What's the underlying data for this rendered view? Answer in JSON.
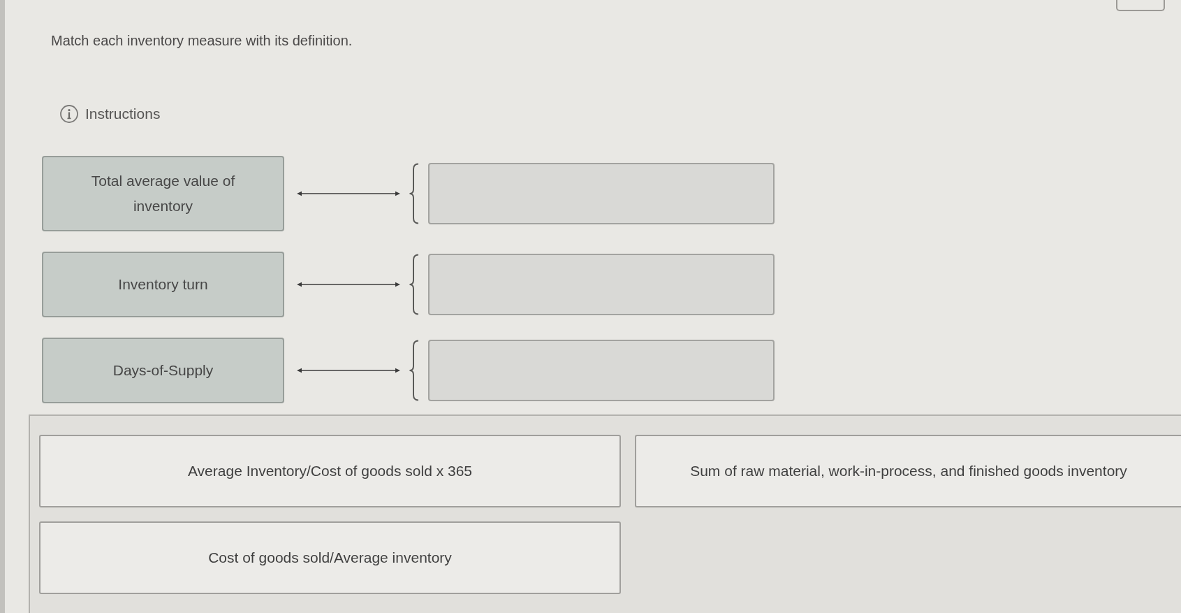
{
  "prompt": "Match each inventory measure with its definition.",
  "instructions": {
    "label": "Instructions"
  },
  "match_rows": [
    {
      "term": "Total average value of inventory"
    },
    {
      "term": "Inventory turn"
    },
    {
      "term": "Days-of-Supply"
    }
  ],
  "answer_choices": [
    "Average Inventory/Cost of goods sold x 365",
    "Sum of raw material, work-in-process, and finished goods inventory",
    "Cost of goods sold/Average inventory"
  ]
}
